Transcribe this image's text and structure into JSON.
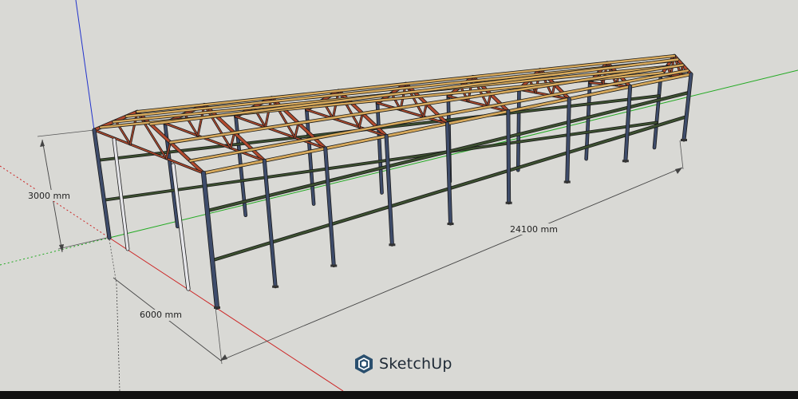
{
  "app": {
    "brand": "SketchUp",
    "logo_icon": "sketchup-logo-icon"
  },
  "dimensions": {
    "height": "3000 mm",
    "width": "6000 mm",
    "length": "24100 mm"
  },
  "model": {
    "bays": 8,
    "girt_rows": 2
  },
  "colors": {
    "background": "#d9d9d5",
    "column": "#3e4c6b",
    "column_light": "#e6e6ea",
    "girt": "#3c5030",
    "truss": "#b24a2e",
    "purlin": "#d8aa5c",
    "axis_red": "#cc2222",
    "axis_green": "#22aa22",
    "axis_blue": "#2233cc",
    "brand": "#2a4f6e"
  }
}
